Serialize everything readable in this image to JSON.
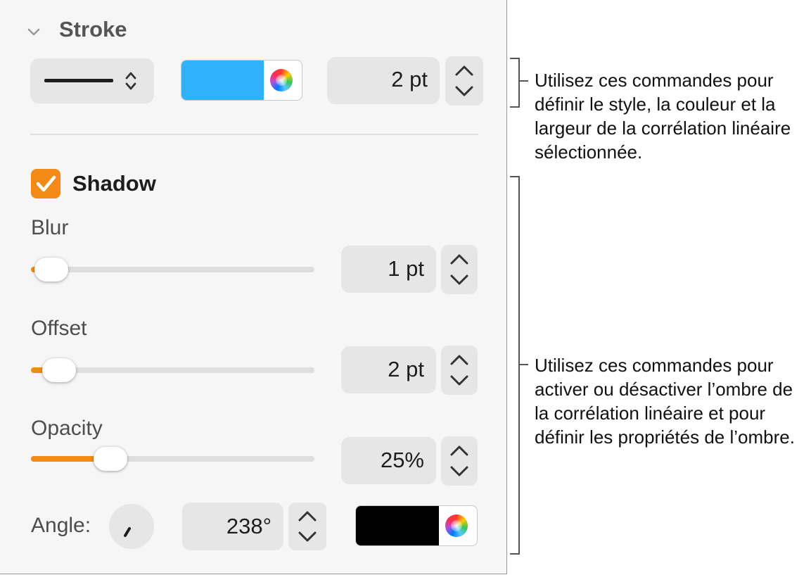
{
  "stroke": {
    "title": "Stroke",
    "color": "#2fb2fa",
    "width_value": "2 pt"
  },
  "shadow": {
    "title": "Shadow",
    "checked": true,
    "blur": {
      "label": "Blur",
      "value": "1 pt",
      "level": 0.02
    },
    "offset": {
      "label": "Offset",
      "value": "2 pt",
      "level": 0.08
    },
    "opacity": {
      "label": "Opacity",
      "value": "25%",
      "level": 0.25
    },
    "angle": {
      "label": "Angle:",
      "value": "238°"
    },
    "color": "#000000"
  },
  "callouts": {
    "stroke": "Utilisez ces commandes pour définir le style, la couleur et la largeur de la corrélation linéaire sélectionnée.",
    "shadow": "Utilisez ces commandes pour activer ou désactiver l’ombre de la corrélation linéaire et pour définir les propriétés de l’ombre."
  },
  "colors": {
    "accent": "#f28b16"
  },
  "icons": [
    "chevron-down-icon",
    "up-down-chevron-icon",
    "color-wheel-icon",
    "checkmark-icon",
    "stepper-up-icon",
    "stepper-down-icon",
    "angle-dial-icon"
  ]
}
